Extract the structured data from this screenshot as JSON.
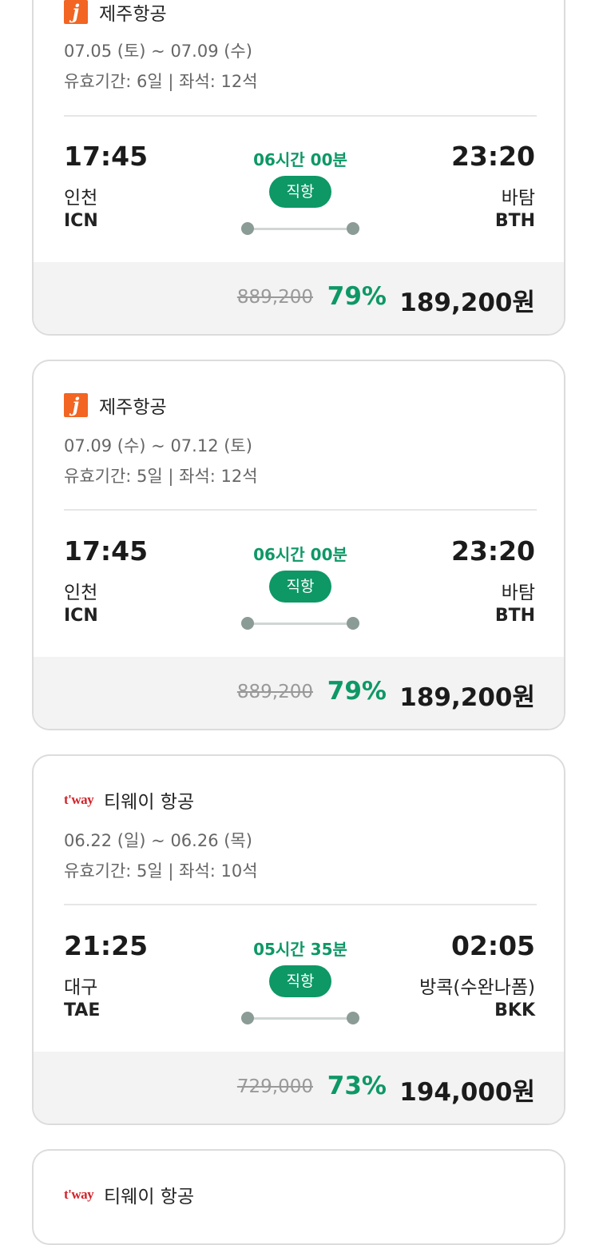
{
  "flights": [
    {
      "airline": "제주항공",
      "logo": "j",
      "dates": "07.05 (토) ~ 07.09 (수)",
      "validity": "유효기간: 6일 | 좌석: 12석",
      "dep_time": "17:45",
      "dep_city": "인천",
      "dep_code": "ICN",
      "duration": "06시간 00분",
      "type": "직항",
      "arr_time": "23:20",
      "arr_city": "바탐",
      "arr_code": "BTH",
      "orig_price": "889,200",
      "discount": "79%",
      "price": "189,200원"
    },
    {
      "airline": "제주항공",
      "logo": "j",
      "dates": "07.09 (수) ~ 07.12 (토)",
      "validity": "유효기간: 5일 | 좌석: 12석",
      "dep_time": "17:45",
      "dep_city": "인천",
      "dep_code": "ICN",
      "duration": "06시간 00분",
      "type": "직항",
      "arr_time": "23:20",
      "arr_city": "바탐",
      "arr_code": "BTH",
      "orig_price": "889,200",
      "discount": "79%",
      "price": "189,200원"
    },
    {
      "airline": "티웨이 항공",
      "logo": "t'way",
      "dates": "06.22 (일) ~ 06.26 (목)",
      "validity": "유효기간: 5일 | 좌석: 10석",
      "dep_time": "21:25",
      "dep_city": "대구",
      "dep_code": "TAE",
      "duration": "05시간 35분",
      "type": "직항",
      "arr_time": "02:05",
      "arr_city": "방콕(수완나폼)",
      "arr_code": "BKK",
      "orig_price": "729,000",
      "discount": "73%",
      "price": "194,000원"
    },
    {
      "airline": "티웨이 항공",
      "logo": "t'way"
    }
  ],
  "colors": {
    "accent": "#0d9866",
    "jeju": "#f26522",
    "tway": "#d2232a"
  }
}
